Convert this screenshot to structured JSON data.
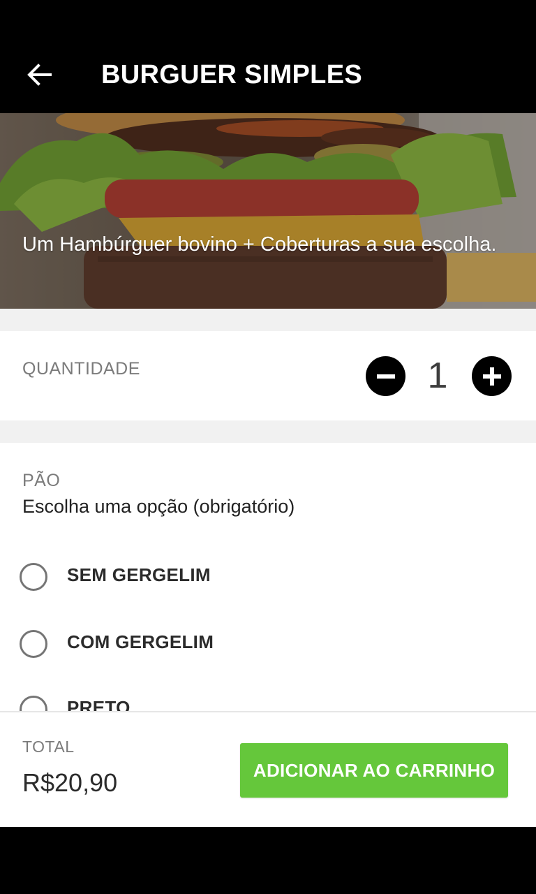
{
  "header": {
    "title": "BURGUER SIMPLES",
    "back_icon": "arrow-left-icon"
  },
  "hero": {
    "description": "Um Hambúrguer bovino + Coberturas a sua escolha."
  },
  "quantity": {
    "label": "QUANTIDADE",
    "value": "1",
    "minus_icon": "minus-circle-icon",
    "plus_icon": "plus-circle-icon"
  },
  "bread": {
    "title": "PÃO",
    "subtitle": "Escolha uma opção (obrigatório)",
    "options": [
      {
        "label": "SEM GERGELIM",
        "selected": false
      },
      {
        "label": "COM GERGELIM",
        "selected": false
      },
      {
        "label": "PRETO",
        "selected": false
      }
    ]
  },
  "footer": {
    "total_label": "TOTAL",
    "total_value": "R$20,90",
    "add_button": "ADICIONAR AO CARRINHO"
  },
  "colors": {
    "accent": "#65c73b",
    "header_bg": "#000000",
    "section_bg": "#f1f1f1"
  }
}
